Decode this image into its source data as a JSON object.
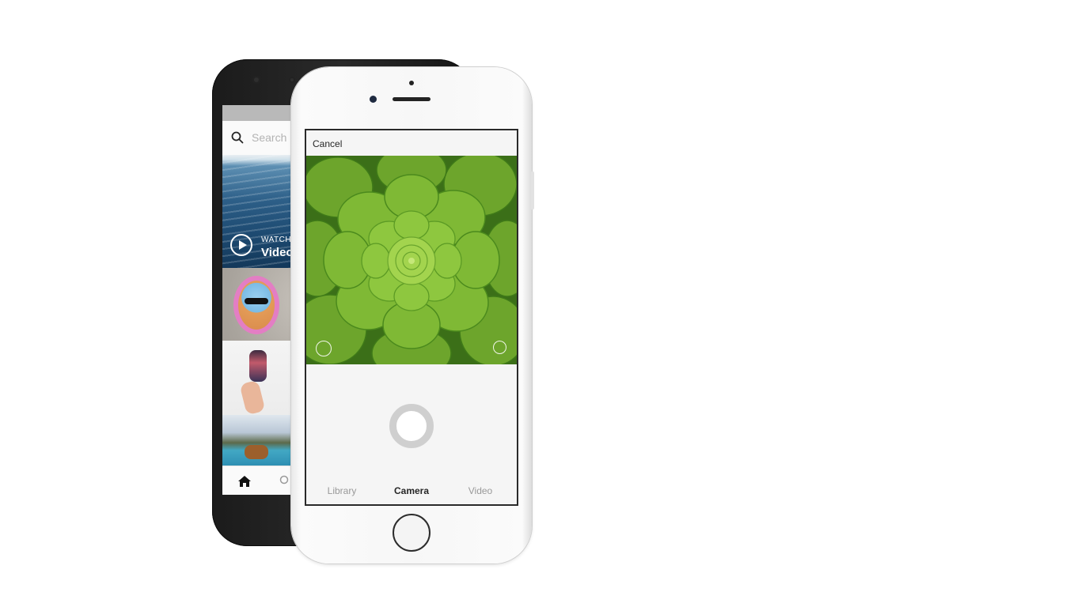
{
  "back_phone": {
    "search_placeholder": "Search",
    "feed": {
      "watch_label": "WATCH",
      "video_label": "Video"
    },
    "tabbar": [
      "home-icon",
      "search-icon"
    ]
  },
  "front_phone": {
    "header": {
      "cancel_label": "Cancel"
    },
    "viewfinder_icons": [
      "flip-camera-icon",
      "flash-icon"
    ],
    "tabs": [
      {
        "label": "Library",
        "active": false
      },
      {
        "label": "Camera",
        "active": true
      },
      {
        "label": "Video",
        "active": false
      }
    ]
  },
  "colors": {
    "accent_text": "#262626",
    "inactive_text": "#999999",
    "background": "#ffffff"
  }
}
